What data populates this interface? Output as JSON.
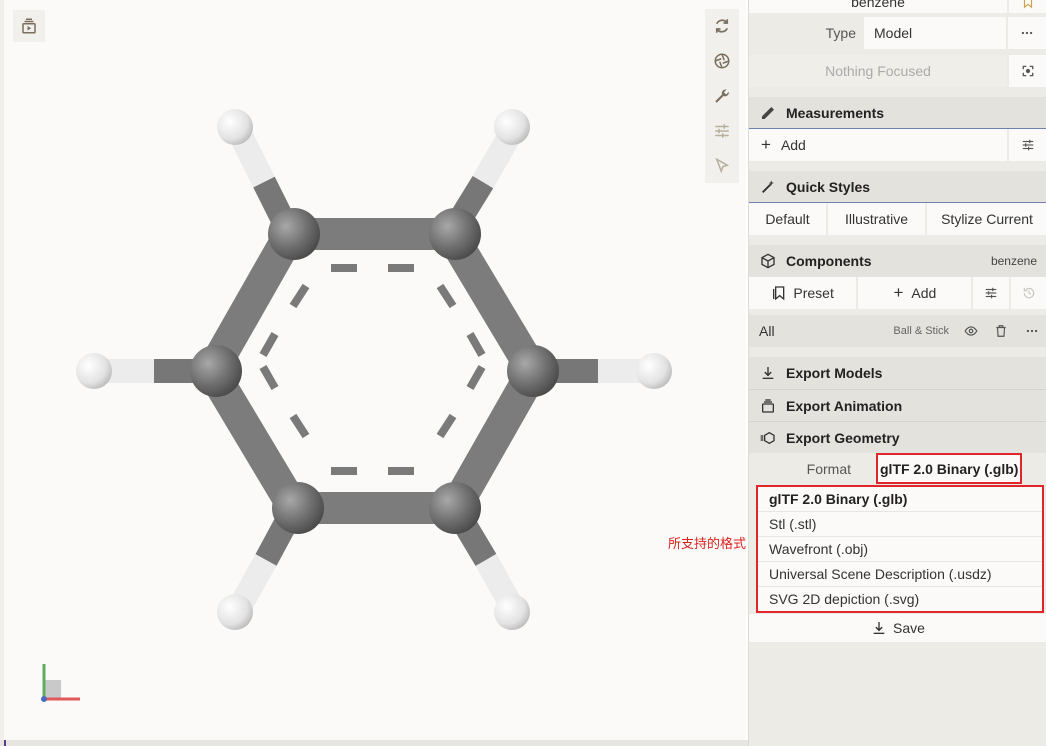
{
  "panel": {
    "structure_name": "benzene",
    "type_label": "Type",
    "type_value": "Model",
    "focus_text": "Nothing Focused",
    "measurements": {
      "title": "Measurements",
      "add_label": "Add"
    },
    "quick_styles": {
      "title": "Quick Styles",
      "buttons": [
        "Default",
        "Illustrative",
        "Stylize Current"
      ]
    },
    "components": {
      "title": "Components",
      "badge": "benzene",
      "preset_label": "Preset",
      "add_label": "Add"
    },
    "component_row": {
      "name": "All",
      "repr": "Ball & Stick"
    },
    "export_models": {
      "title": "Export Models"
    },
    "export_animation": {
      "title": "Export Animation"
    },
    "export_geometry": {
      "title": "Export Geometry",
      "format_label": "Format",
      "format_value": "glTF 2.0 Binary (.glb)",
      "options": [
        "glTF 2.0 Binary (.glb)",
        "Stl (.stl)",
        "Wavefront (.obj)",
        "Universal Scene Description (.usdz)",
        "SVG 2D depiction (.svg)"
      ],
      "selected_option": "glTF 2.0 Binary (.glb)",
      "save_label": "Save"
    }
  },
  "annotation": "所支持的格式",
  "molecule": {
    "name": "benzene",
    "representation": "ball-and-stick"
  },
  "colors": {
    "highlight": "#e0262b",
    "carbon": "#7c7c7c",
    "hydrogen": "#f2f2f2",
    "panel_bg": "#ecebe6",
    "viewport_bg": "#fbfaf8"
  },
  "icons": {
    "viewport_left": "animation-icon",
    "viewport_right": [
      "reset-camera-icon",
      "screenshot-icon",
      "wrench-icon",
      "settings-icon",
      "pointer-icon"
    ]
  }
}
